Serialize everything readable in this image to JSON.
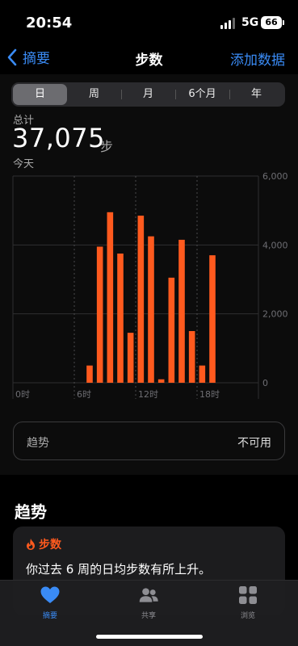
{
  "status": {
    "time": "20:54",
    "network": "5G",
    "battery": "66"
  },
  "nav": {
    "back_label": "摘要",
    "title": "步数",
    "add_label": "添加数据"
  },
  "segments": [
    {
      "label": "日",
      "selected": true
    },
    {
      "label": "周",
      "selected": false
    },
    {
      "label": "月",
      "selected": false
    },
    {
      "label": "6个月",
      "selected": false
    },
    {
      "label": "年",
      "selected": false
    }
  ],
  "summary": {
    "label": "总计",
    "value": "37,075",
    "unit": "步",
    "period": "今天"
  },
  "chart_data": {
    "type": "bar",
    "x_ticks": [
      "0时",
      "6时",
      "12时",
      "18时"
    ],
    "y_ticks": [
      "0",
      "2,000",
      "4,000",
      "6,000"
    ],
    "ylim": [
      0,
      6000
    ],
    "color": "#ff5a1e",
    "categories": [
      "0",
      "1",
      "2",
      "3",
      "4",
      "5",
      "6",
      "7",
      "8",
      "9",
      "10",
      "11",
      "12",
      "13",
      "14",
      "15",
      "16",
      "17",
      "18",
      "19",
      "20",
      "21",
      "22",
      "23"
    ],
    "values": [
      0,
      0,
      0,
      0,
      0,
      0,
      0,
      500,
      3950,
      4950,
      3750,
      1450,
      4850,
      4250,
      100,
      3050,
      4150,
      1500,
      500,
      3700,
      0,
      0,
      0,
      0
    ]
  },
  "trend_row": {
    "label": "趋势",
    "value": "不可用"
  },
  "trends_section": {
    "title": "趋势",
    "card_title": "步数",
    "card_text": "你过去 6 周的日均步数有所上升。"
  },
  "tabs": [
    {
      "label": "摘要",
      "icon": "heart-icon",
      "active": true
    },
    {
      "label": "共享",
      "icon": "people-icon",
      "active": false
    },
    {
      "label": "浏览",
      "icon": "grid-icon",
      "active": false
    }
  ],
  "colors": {
    "accent": "#3a8bf5",
    "steps": "#ff5a1e"
  }
}
